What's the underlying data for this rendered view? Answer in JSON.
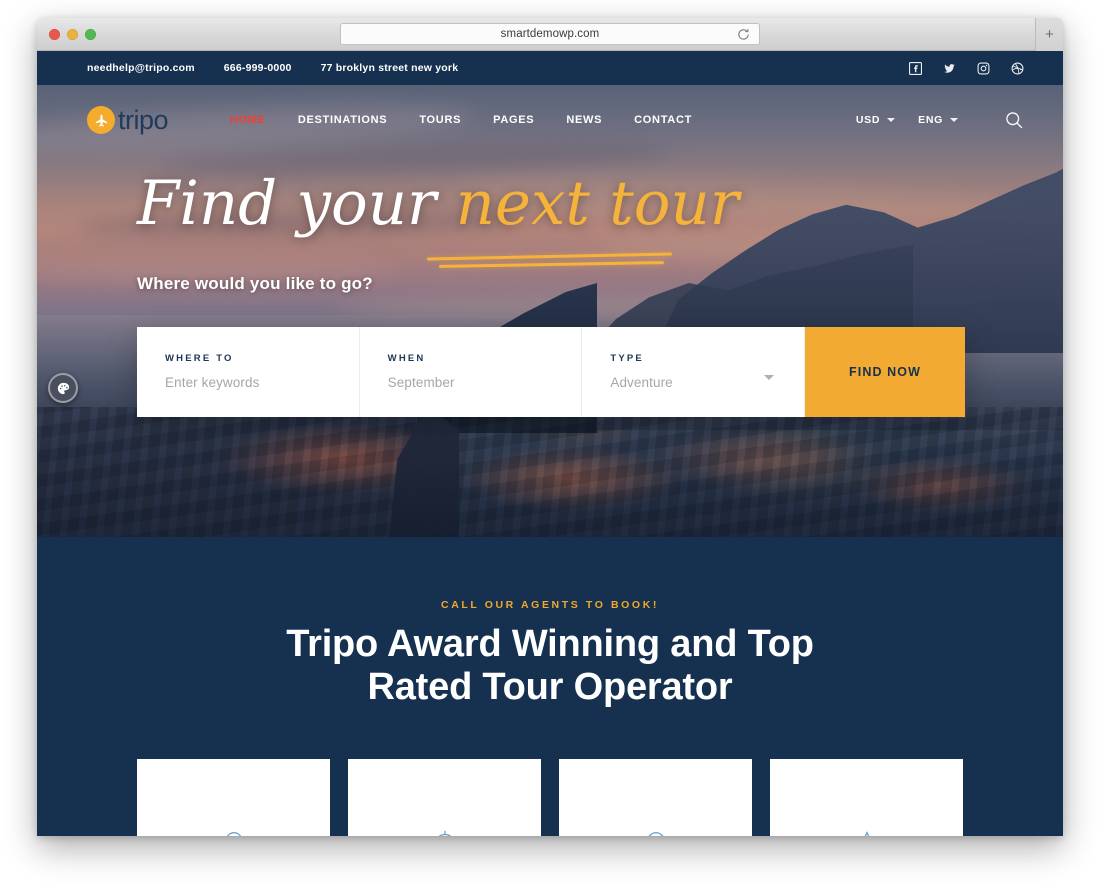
{
  "browser": {
    "url": "smartdemowp.com",
    "reload_icon": "reload-icon",
    "new_tab_label": "+",
    "traffic_lights": [
      "close",
      "minimize",
      "maximize"
    ]
  },
  "topbar": {
    "email": "needhelp@tripo.com",
    "phone": "666-999-0000",
    "address": "77 broklyn street new york",
    "social": [
      {
        "name": "facebook-icon"
      },
      {
        "name": "twitter-icon"
      },
      {
        "name": "instagram-icon"
      },
      {
        "name": "dribbble-icon"
      }
    ]
  },
  "nav": {
    "logo_text": "tripo",
    "logo_icon": "airplane-icon",
    "menu": [
      {
        "label": "HOME",
        "active": true
      },
      {
        "label": "DESTINATIONS",
        "active": false
      },
      {
        "label": "TOURS",
        "active": false
      },
      {
        "label": "PAGES",
        "active": false
      },
      {
        "label": "NEWS",
        "active": false
      },
      {
        "label": "CONTACT",
        "active": false
      }
    ],
    "currency": "USD",
    "language": "ENG",
    "search_icon": "search-icon",
    "active_color": "#f2402e"
  },
  "hero": {
    "headline_plain": "Find your",
    "headline_accent": "next tour",
    "subtitle": "Where would you like to go?",
    "accent_color": "#f5b33c"
  },
  "search_form": {
    "where": {
      "label": "WHERE TO",
      "placeholder": "Enter keywords",
      "value": ""
    },
    "when": {
      "label": "WHEN",
      "placeholder": "September",
      "value": ""
    },
    "type": {
      "label": "TYPE",
      "value": "Adventure",
      "options": [
        "Adventure"
      ]
    },
    "submit_label": "FIND NOW",
    "submit_color": "#f2aa33"
  },
  "theme_switcher": {
    "icon": "palette-icon"
  },
  "features": {
    "eyebrow": "CALL OUR AGENTS TO BOOK!",
    "title_line1": "Tripo Award Winning and Top",
    "title_line2": "Rated Tour Operator",
    "eyebrow_color": "#f0a92e",
    "background": "#16304f",
    "cards": [
      {
        "icon": "tour-guide-icon"
      },
      {
        "icon": "monument-tent-icon"
      },
      {
        "icon": "award-badge-icon"
      },
      {
        "icon": "star-rating-icon"
      }
    ]
  }
}
